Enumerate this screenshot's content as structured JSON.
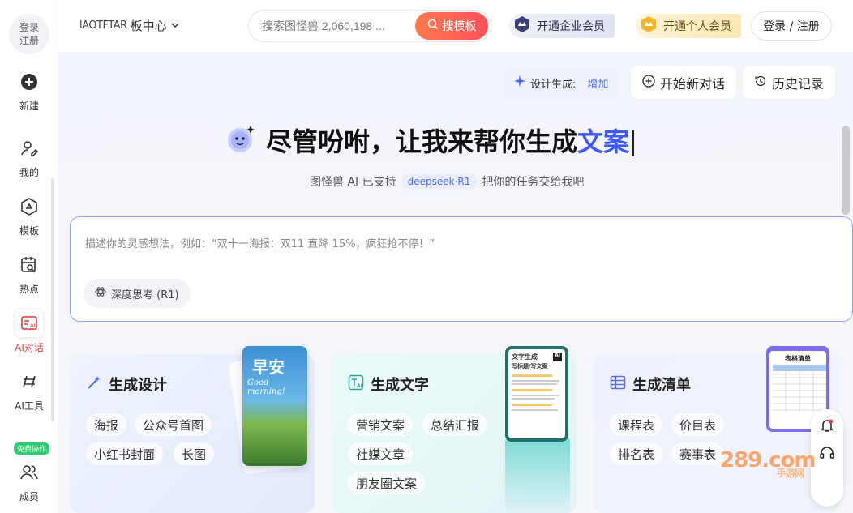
{
  "sidebar": {
    "login": {
      "line1": "登录",
      "line2": "注册"
    },
    "items": [
      {
        "label": "新建",
        "icon": "plus-circle-icon"
      },
      {
        "label": "我的",
        "icon": "user-edit-icon"
      },
      {
        "label": "模板",
        "icon": "template-icon"
      },
      {
        "label": "热点",
        "icon": "hot-search-icon"
      },
      {
        "label": "AI对话",
        "icon": "ai-chat-icon"
      },
      {
        "label": "AI工具",
        "icon": "ai-tools-icon"
      },
      {
        "label": "成员",
        "icon": "members-icon"
      }
    ],
    "free_badge": "免费协作"
  },
  "topbar": {
    "brand_garbled": "lAOTFTAR",
    "brand_suffix": "板中心",
    "search_placeholder": "搜索图怪兽 2,060,198 ...",
    "search_button": "搜模板",
    "vip_enterprise": "开通企业会员",
    "vip_personal": "开通个人会员",
    "login": "登录 / 注册"
  },
  "main": {
    "credit_label": "设计生成:",
    "credit_add": "增加",
    "new_chat": "开始新对话",
    "history": "历史记录",
    "hero_prefix": "尽管吩咐，让我来帮你生成",
    "hero_highlight": "文案",
    "sub_prefix": "图怪兽 AI 已支持",
    "sub_badge": "deepseek·R1",
    "sub_suffix": "把你的任务交给我吧",
    "prompt_placeholder": "描述你的灵感想法，例如：“双十一海报：双11 直降 15%，疯狂抢不停！”",
    "deep_think": "深度思考 (R1)"
  },
  "cards": [
    {
      "title": "生成设计",
      "tags": [
        "海报",
        "公众号首图",
        "小红书封面",
        "长图"
      ],
      "thumb_text": "早安",
      "thumb_script": "Good morning!"
    },
    {
      "title": "生成文字",
      "tags": [
        "营销文案",
        "总结汇报",
        "社媒文章",
        "朋友圈文案"
      ],
      "thumb_title": "文字生成",
      "thumb_sub": "写标题/写文案",
      "thumb_ai": "AI"
    },
    {
      "title": "生成清单",
      "tags": [
        "课程表",
        "价目表",
        "排名表",
        "赛事表"
      ],
      "thumb_title": "表格清单"
    }
  ],
  "watermark": {
    "main": "289.com",
    "sub": "手游网"
  }
}
